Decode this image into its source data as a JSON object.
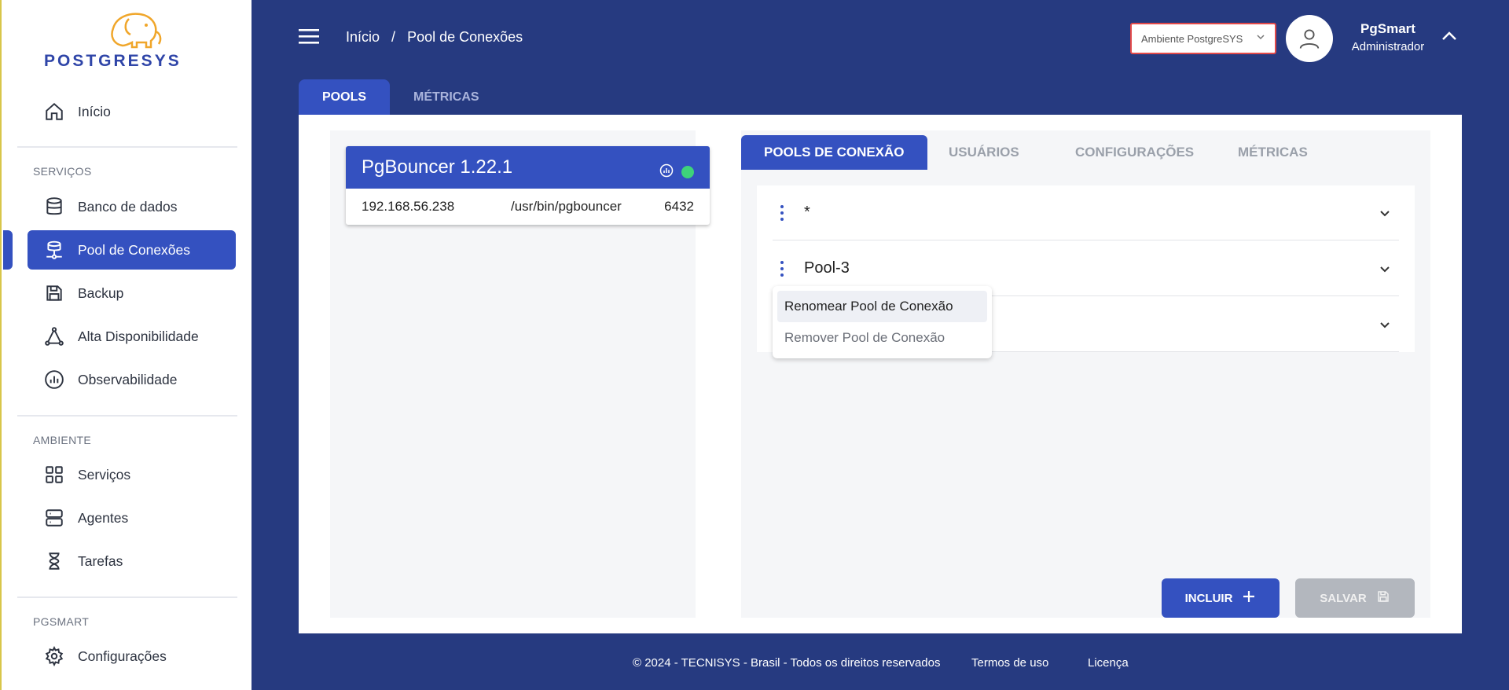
{
  "brand": {
    "logo_text": "POSTGRESYS"
  },
  "sidebar": {
    "home": "Início",
    "sections": {
      "services": "SERVIÇOS",
      "environment": "AMBIENTE",
      "pgsmart": "PGSMART"
    },
    "items": [
      {
        "label": "Banco de dados",
        "icon": "database-icon"
      },
      {
        "label": "Pool de Conexões",
        "icon": "connection-pool-icon",
        "active": true
      },
      {
        "label": "Backup",
        "icon": "floppy-disk-icon"
      },
      {
        "label": "Alta Disponibilidade",
        "icon": "triangle-nodes-icon"
      },
      {
        "label": "Observabilidade",
        "icon": "chart-circle-icon"
      },
      {
        "label": "Serviços",
        "icon": "grid-icon"
      },
      {
        "label": "Agentes",
        "icon": "server-icon"
      },
      {
        "label": "Tarefas",
        "icon": "hourglass-icon"
      },
      {
        "label": "Configurações",
        "icon": "gear-icon"
      }
    ]
  },
  "header": {
    "breadcrumb": {
      "home": "Início",
      "separator": "/",
      "current": "Pool de Conexões"
    },
    "environment_select": "Ambiente PostgreSYS",
    "user": {
      "name": "PgSmart",
      "role": "Administrador"
    }
  },
  "top_tabs": [
    "POOLS",
    "MÉTRICAS"
  ],
  "pgbouncer": {
    "title": "PgBouncer 1.22.1",
    "ip": "192.168.56.238",
    "path": "/usr/bin/pgbouncer",
    "port": "6432"
  },
  "sub_tabs": [
    "POOLS DE CONEXÃO",
    "USUÁRIOS",
    "CONFIGURAÇÕES",
    "MÉTRICAS"
  ],
  "pools": [
    {
      "name": "*"
    },
    {
      "name": "Pool-3"
    },
    {
      "name": ""
    }
  ],
  "context_menu": {
    "rename": "Renomear Pool de Conexão",
    "remove": "Remover Pool de Conexão"
  },
  "actions": {
    "include": "INCLUIR",
    "save": "SALVAR"
  },
  "footer": {
    "copyright": "© 2024 - TECNISYS - Brasil - Todos os direitos reservados",
    "terms": "Termos de uso",
    "license": "Licença"
  },
  "colors": {
    "primary": "#3451c0",
    "background": "#263a80",
    "status_online": "#3ed37a"
  }
}
